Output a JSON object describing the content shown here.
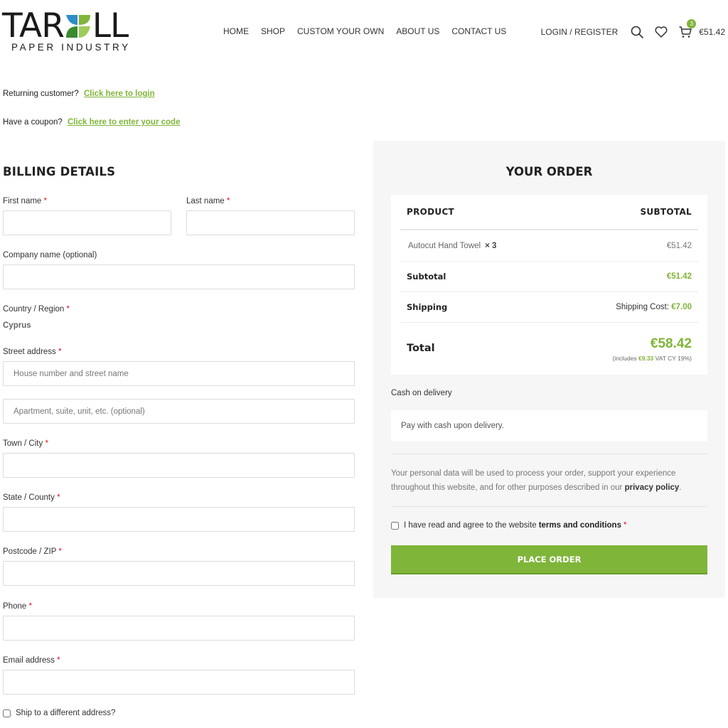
{
  "brand": {
    "name_start": "TAR",
    "name_end": "LL",
    "tagline": "PAPER INDUSTRY",
    "colors": {
      "accent": "#7fb539",
      "leaf_blue": "#2f8cc9",
      "leaf_dark_green": "#3a8a2e",
      "text_dark": "#1a1a1a"
    }
  },
  "nav": {
    "items": [
      {
        "label": "HOME"
      },
      {
        "label": "SHOP"
      },
      {
        "label": "CUSTOM YOUR OWN"
      },
      {
        "label": "ABOUT US"
      },
      {
        "label": "CONTACT US"
      }
    ]
  },
  "header": {
    "login_label": "LOGIN / REGISTER",
    "search_icon": "search-icon",
    "wishlist_icon": "heart-icon",
    "cart_icon": "cart-icon",
    "cart_count": "3",
    "cart_total": "€51.42"
  },
  "notices": {
    "returning_text": "Returning customer?",
    "returning_link": "Click here to login",
    "coupon_text": "Have a coupon?",
    "coupon_link": "Click here to enter your code"
  },
  "billing": {
    "title": "BILLING DETAILS",
    "first_name_label": "First name",
    "last_name_label": "Last name",
    "company_label": "Company name (optional)",
    "country_label": "Country / Region",
    "country_value": "Cyprus",
    "street_label": "Street address",
    "street_placeholder": "House number and street name",
    "apartment_placeholder": "Apartment, suite, unit, etc. (optional)",
    "city_label": "Town / City",
    "state_label": "State / County",
    "postcode_label": "Postcode / ZIP",
    "phone_label": "Phone",
    "email_label": "Email address",
    "required_mark": "*",
    "ship_different_label": "Ship to a different address?"
  },
  "order": {
    "title": "YOUR ORDER",
    "col_product": "PRODUCT",
    "col_subtotal": "SUBTOTAL",
    "items": [
      {
        "name": "Autocut Hand Towel",
        "qty": "× 3",
        "price": "€51.42"
      }
    ],
    "subtotal_label": "Subtotal",
    "subtotal_value": "€51.42",
    "shipping_label": "Shipping",
    "shipping_prefix": "Shipping Cost:",
    "shipping_value": "€7.00",
    "total_label": "Total",
    "total_value": "€58.42",
    "vat_prefix": "(includes",
    "vat_amount": "€9.33",
    "vat_suffix": "VAT CY 19%)",
    "payment_method": "Cash on delivery",
    "payment_description": "Pay with cash upon delivery.",
    "privacy_text": "Your personal data will be used to process your order, support your experience throughout this website, and for other purposes described in our",
    "privacy_link": "privacy policy",
    "privacy_end": ".",
    "terms_text": "I have read and agree to the website",
    "terms_link": "terms and conditions",
    "terms_required": "*",
    "place_order_label": "PLACE ORDER"
  }
}
